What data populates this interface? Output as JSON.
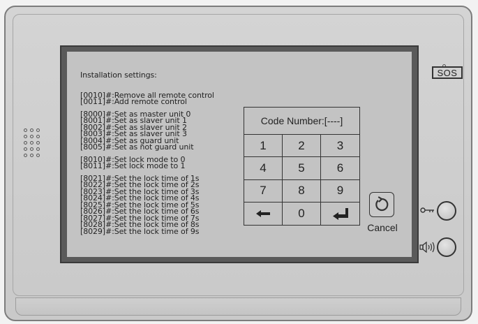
{
  "settings": {
    "title": "Installation settings:",
    "groups": [
      [
        "[0010]#:Remove all remote control",
        "[0011]#:Add remote control"
      ],
      [
        "[8000]#:Set as master unit 0",
        "[8001]#:Set as slaver unit 1",
        "[8002]#:Set as slaver unit 2",
        "[8003]#:Set as slaver unit 3",
        "[8004]#:Set as guard unit",
        "[8005]#:Set as not guard unit"
      ],
      [
        "[8010]#:Set lock mode to 0",
        "[8011]#:Set lock mode to 1"
      ],
      [
        "[8021]#:Set the lock time of 1s",
        "[8022]#:Set the lock time of 2s",
        "[8023]#:Set the lock time of 3s",
        "[8024]#:Set the lock time of 4s",
        "[8025]#:Set the lock time of 5s",
        "[8026]#:Set the lock time of 6s",
        "[8027]#:Set the lock time of 7s",
        "[8028]#:Set the lock time of 8s",
        "[8029]#:Set the lock time of 9s"
      ]
    ]
  },
  "keypad": {
    "display": "Code Number:[----]",
    "keys": [
      {
        "label": "1",
        "name": "key-1"
      },
      {
        "label": "2",
        "name": "key-2"
      },
      {
        "label": "3",
        "name": "key-3"
      },
      {
        "label": "4",
        "name": "key-4"
      },
      {
        "label": "5",
        "name": "key-5"
      },
      {
        "label": "6",
        "name": "key-6"
      },
      {
        "label": "7",
        "name": "key-7"
      },
      {
        "label": "8",
        "name": "key-8"
      },
      {
        "label": "9",
        "name": "key-9"
      },
      {
        "label": "",
        "name": "key-backspace",
        "icon": "arrow-left-icon"
      },
      {
        "label": "0",
        "name": "key-0"
      },
      {
        "label": "",
        "name": "key-enter",
        "icon": "enter-icon"
      }
    ]
  },
  "cancel": {
    "label": "Cancel",
    "icon": "undo-icon"
  },
  "sos": {
    "label": "SOS"
  },
  "buttons": [
    {
      "name": "unlock-button",
      "icon": "key-icon"
    },
    {
      "name": "talk-button",
      "icon": "speaker-icon"
    }
  ],
  "colors": {
    "screen": "#c3c3c3",
    "bezel": "#d0d0d0",
    "ink": "#222222"
  }
}
